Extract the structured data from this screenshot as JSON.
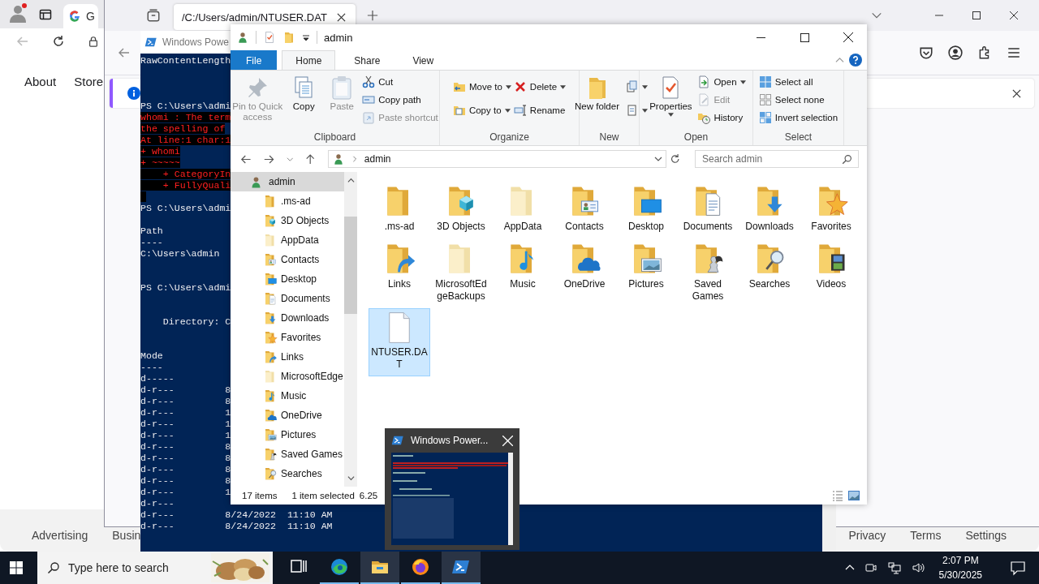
{
  "google_window": {
    "tab": {
      "title": "G"
    },
    "nav_links": [
      "About",
      "Store"
    ],
    "footer_left": [
      "Advertising",
      "Busin"
    ],
    "footer_right": [
      "Privacy",
      "Terms",
      "Settings"
    ]
  },
  "firefox_window": {
    "tab": {
      "title": "/C:/Users/admin/NTUSER.DAT"
    }
  },
  "powershell_window": {
    "title": "Windows Powe",
    "blocks": [
      [
        {
          "text": "RawContentLength",
          "kind": "output"
        }
      ],
      [
        {
          "text": "PS C:\\Users\\admi",
          "kind": "output"
        },
        {
          "text": "whomi : The term",
          "kind": "error"
        },
        {
          "text": "the spelling of",
          "kind": "error"
        },
        {
          "text": "At line:1 char:1",
          "kind": "error"
        },
        {
          "text": "+ whomi",
          "kind": "error"
        },
        {
          "text": "+ ~~~~~",
          "kind": "error"
        },
        {
          "text": "    + CategoryIn",
          "kind": "error"
        },
        {
          "text": "    + FullyQuali",
          "kind": "error"
        }
      ],
      [
        {
          "text": "PS C:\\Users\\admi",
          "kind": "output"
        }
      ],
      [
        {
          "text": "Path",
          "kind": "output"
        },
        {
          "text": "----",
          "kind": "output"
        },
        {
          "text": "C:\\Users\\admin",
          "kind": "output"
        }
      ],
      [
        {
          "text": "PS C:\\Users\\admi",
          "kind": "output"
        }
      ],
      [
        {
          "text": "    Directory: C",
          "kind": "output"
        }
      ],
      [
        {
          "text": "Mode",
          "kind": "output"
        },
        {
          "text": "----",
          "kind": "output"
        },
        {
          "text": "d-----",
          "kind": "output"
        },
        {
          "text": "d-r---         8",
          "kind": "output"
        },
        {
          "text": "d-r---         8",
          "kind": "output"
        },
        {
          "text": "d-r---         1",
          "kind": "output"
        },
        {
          "text": "d-r---         1",
          "kind": "output"
        },
        {
          "text": "d-r---         1",
          "kind": "output"
        },
        {
          "text": "d-r---         8",
          "kind": "output"
        },
        {
          "text": "d-r---         8",
          "kind": "output"
        },
        {
          "text": "d-r---         8",
          "kind": "output"
        },
        {
          "text": "d-r---         8",
          "kind": "output"
        },
        {
          "text": "d-r---         1",
          "kind": "output"
        },
        {
          "text": "d-r---",
          "kind": "output"
        },
        {
          "text": "d-r---         8/24/2022  11:10 AM",
          "kind": "output"
        },
        {
          "text": "d-r---         8/24/2022  11:10 AM",
          "kind": "output"
        }
      ]
    ]
  },
  "explorer": {
    "title": "admin",
    "tabs": [
      {
        "label": "File",
        "kind": "file",
        "selected": false
      },
      {
        "label": "Home",
        "kind": "tab",
        "selected": true
      },
      {
        "label": "Share",
        "kind": "tab",
        "selected": false
      },
      {
        "label": "View",
        "kind": "tab",
        "selected": false
      }
    ],
    "ribbon": [
      {
        "label": "Clipboard",
        "commands": [
          {
            "kind": "large",
            "label": "Pin to Quick access",
            "disabled": true,
            "dropdown": false
          },
          {
            "kind": "large",
            "label": "Copy",
            "disabled": false,
            "dropdown": false
          },
          {
            "kind": "large",
            "label": "Paste",
            "disabled": true,
            "dropdown": false
          },
          {
            "kind": "stack",
            "commands": [
              {
                "label": "Cut",
                "disabled": false,
                "dropdown": false
              },
              {
                "label": "Copy path",
                "disabled": false,
                "dropdown": false
              },
              {
                "label": "Paste shortcut",
                "disabled": true,
                "dropdown": false
              }
            ]
          }
        ]
      },
      {
        "label": "Organize",
        "commands": [
          {
            "kind": "stack",
            "commands": [
              {
                "label": "Move to",
                "disabled": false,
                "dropdown": true
              },
              {
                "label": "Copy to",
                "disabled": false,
                "dropdown": true
              }
            ]
          },
          {
            "kind": "stack",
            "commands": [
              {
                "label": "Delete",
                "disabled": false,
                "dropdown": true
              },
              {
                "label": "Rename",
                "disabled": false,
                "dropdown": false
              }
            ]
          }
        ]
      },
      {
        "label": "New",
        "commands": [
          {
            "kind": "large",
            "label": "New folder",
            "disabled": false,
            "dropdown": false
          },
          {
            "kind": "stack",
            "commands": [
              {
                "disabled": false,
                "dropdown": true
              },
              {
                "disabled": false,
                "dropdown": true
              }
            ]
          }
        ]
      },
      {
        "label": "Open",
        "commands": [
          {
            "kind": "large",
            "label": "Properties",
            "disabled": false,
            "dropdown": true
          },
          {
            "kind": "stack",
            "commands": [
              {
                "label": "Open",
                "disabled": false,
                "dropdown": true
              },
              {
                "label": "Edit",
                "disabled": true,
                "dropdown": false
              },
              {
                "label": "History",
                "disabled": false,
                "dropdown": false
              }
            ]
          }
        ]
      },
      {
        "label": "Select",
        "commands": [
          {
            "kind": "stack",
            "commands": [
              {
                "label": "Select all",
                "disabled": false,
                "dropdown": false
              },
              {
                "label": "Select none",
                "disabled": false,
                "dropdown": false
              },
              {
                "label": "Invert selection",
                "disabled": false,
                "dropdown": false
              }
            ]
          }
        ]
      }
    ],
    "address": {
      "path": "admin"
    },
    "search": {
      "placeholder": "Search admin"
    },
    "nav": [
      {
        "label": "admin",
        "kind": "user",
        "selected": true,
        "children": [
          {
            "label": ".ms-ad",
            "kind": "folder",
            "selected": false
          },
          {
            "label": "3D Objects",
            "kind": "objects",
            "selected": false
          },
          {
            "label": "AppData",
            "kind": "hidden",
            "selected": false
          },
          {
            "label": "Contacts",
            "kind": "contacts",
            "selected": false
          },
          {
            "label": "Desktop",
            "kind": "desktop",
            "selected": false
          },
          {
            "label": "Documents",
            "kind": "documents",
            "selected": false
          },
          {
            "label": "Downloads",
            "kind": "downloads",
            "selected": false
          },
          {
            "label": "Favorites",
            "kind": "favorites",
            "selected": false
          },
          {
            "label": "Links",
            "kind": "links",
            "selected": false
          },
          {
            "label": "MicrosoftEdge",
            "kind": "hidden",
            "selected": false
          },
          {
            "label": "Music",
            "kind": "music",
            "selected": false
          },
          {
            "label": "OneDrive",
            "kind": "onedrive",
            "selected": false
          },
          {
            "label": "Pictures",
            "kind": "pictures",
            "selected": false
          },
          {
            "label": "Saved Games",
            "kind": "games",
            "selected": false
          },
          {
            "label": "Searches",
            "kind": "searches",
            "selected": false
          }
        ]
      }
    ],
    "items": [
      {
        "name": ".ms-ad",
        "kind": "folder",
        "selected": false
      },
      {
        "name": "3D Objects",
        "kind": "objects",
        "selected": false
      },
      {
        "name": "AppData",
        "kind": "hidden",
        "selected": false
      },
      {
        "name": "Contacts",
        "kind": "contacts",
        "selected": false
      },
      {
        "name": "Desktop",
        "kind": "desktop",
        "selected": false
      },
      {
        "name": "Documents",
        "kind": "documents",
        "selected": false
      },
      {
        "name": "Downloads",
        "kind": "downloads",
        "selected": false
      },
      {
        "name": "Favorites",
        "kind": "favorites",
        "selected": false
      },
      {
        "name": "Links",
        "kind": "links",
        "selected": false
      },
      {
        "name": "MicrosoftEdgeBackups",
        "kind": "hidden",
        "selected": false
      },
      {
        "name": "Music",
        "kind": "music",
        "selected": false
      },
      {
        "name": "OneDrive",
        "kind": "onedrive",
        "selected": false
      },
      {
        "name": "Pictures",
        "kind": "pictures",
        "selected": false
      },
      {
        "name": "Saved Games",
        "kind": "games",
        "selected": false
      },
      {
        "name": "Searches",
        "kind": "searches",
        "selected": false
      },
      {
        "name": "Videos",
        "kind": "videos",
        "selected": false
      },
      {
        "name": "NTUSER.DAT",
        "kind": "file",
        "selected": true
      }
    ],
    "status": {
      "count": "17 items",
      "selection": "1 item selected",
      "size": "6.25"
    }
  },
  "taskbar_preview": {
    "title": "Windows Power..."
  },
  "taskbar": {
    "search": {
      "placeholder": "Type here to search"
    },
    "apps": [
      {
        "kind": "taskview",
        "running": false,
        "selected": false
      },
      {
        "kind": "edge",
        "running": true,
        "selected": false
      },
      {
        "kind": "explorer",
        "running": true,
        "selected": true
      },
      {
        "kind": "firefox",
        "running": true,
        "selected": false
      },
      {
        "kind": "powershell",
        "running": true,
        "selected": true
      }
    ],
    "clock": {
      "time": "2:07 PM",
      "date": "5/30/2025"
    }
  }
}
